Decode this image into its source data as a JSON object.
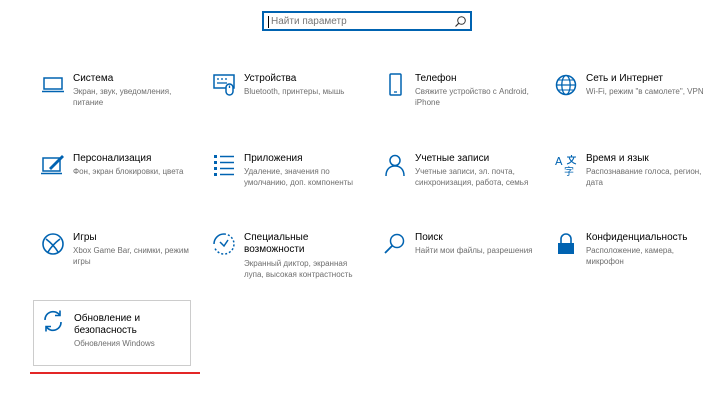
{
  "search": {
    "placeholder": "Найти параметр"
  },
  "colors": {
    "accent": "#0063b1",
    "annotation": "#e32626"
  },
  "tiles": [
    {
      "icon": "laptop-icon",
      "title": "Система",
      "desc": "Экран, звук, уведомления, питание"
    },
    {
      "icon": "devices-icon",
      "title": "Устройства",
      "desc": "Bluetooth, принтеры, мышь"
    },
    {
      "icon": "phone-icon",
      "title": "Телефон",
      "desc": "Свяжите устройство с Android, iPhone"
    },
    {
      "icon": "globe-icon",
      "title": "Сеть и Интернет",
      "desc": "Wi-Fi, режим \"в самолете\", VPN"
    },
    {
      "icon": "personalization-icon",
      "title": "Персонализация",
      "desc": "Фон, экран блокировки, цвета"
    },
    {
      "icon": "apps-icon",
      "title": "Приложения",
      "desc": "Удаление, значения по умолчанию, доп. компоненты"
    },
    {
      "icon": "person-icon",
      "title": "Учетные записи",
      "desc": "Учетные записи, эл. почта, синхронизация, работа, семья"
    },
    {
      "icon": "time-language-icon",
      "title": "Время и язык",
      "desc": "Распознавание голоса, регион, дата"
    },
    {
      "icon": "xbox-icon",
      "title": "Игры",
      "desc": "Xbox Game Bar, снимки, режим игры"
    },
    {
      "icon": "ease-of-access-icon",
      "title": "Специальные возможности",
      "desc": "Экранный диктор, экранная лупа, высокая контрастность"
    },
    {
      "icon": "search-icon",
      "title": "Поиск",
      "desc": "Найти мои файлы, разрешения"
    },
    {
      "icon": "lock-icon",
      "title": "Конфиденциальность",
      "desc": "Расположение, камера, микрофон"
    },
    {
      "icon": "update-icon",
      "title": "Обновление и безопасность",
      "desc": "Обновления Windows"
    }
  ]
}
